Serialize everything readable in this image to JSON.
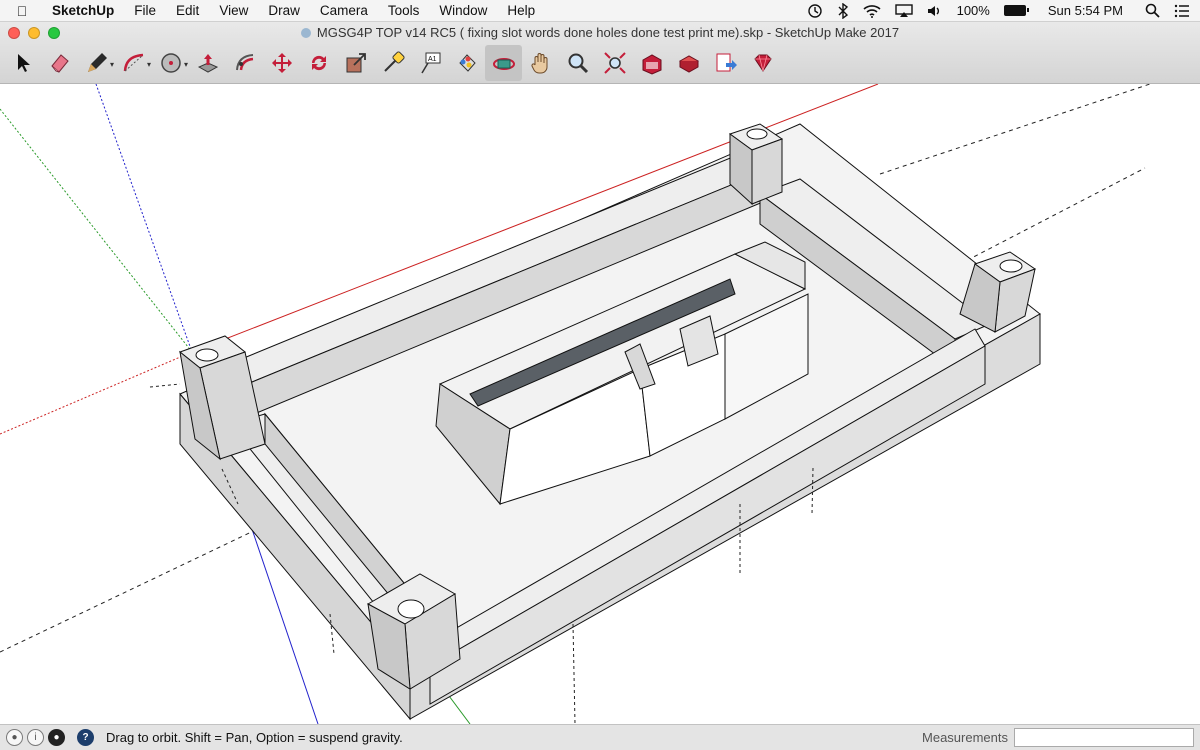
{
  "menubar": {
    "apple_icon": "apple-logo",
    "app_name": "SketchUp",
    "items": [
      "File",
      "Edit",
      "View",
      "Draw",
      "Camera",
      "Tools",
      "Window",
      "Help"
    ],
    "battery": "100%",
    "clock": "Sun 5:54 PM"
  },
  "window": {
    "title": "MGSG4P TOP v14 RC5 ( fixing slot words done holes done test print me).skp - SketchUp Make 2017",
    "traffic_colors": [
      "#ff5f57",
      "#febc2e",
      "#28c840"
    ]
  },
  "toolbar": {
    "tools": [
      {
        "name": "select",
        "icon": "arrow-cursor-icon"
      },
      {
        "name": "eraser",
        "icon": "eraser-icon"
      },
      {
        "name": "line",
        "icon": "pencil-icon",
        "dropdown": true
      },
      {
        "name": "arc",
        "icon": "arc-icon",
        "dropdown": true
      },
      {
        "name": "shapes",
        "icon": "circle-icon",
        "dropdown": true
      },
      {
        "name": "push-pull",
        "icon": "push-pull-icon"
      },
      {
        "name": "offset",
        "icon": "offset-icon"
      },
      {
        "name": "move",
        "icon": "move-icon"
      },
      {
        "name": "rotate",
        "icon": "rotate-icon"
      },
      {
        "name": "scale",
        "icon": "scale-icon"
      },
      {
        "name": "tape-measure",
        "icon": "tape-measure-icon"
      },
      {
        "name": "text",
        "icon": "text-icon",
        "label": "A1"
      },
      {
        "name": "paint-bucket",
        "icon": "paint-bucket-icon"
      },
      {
        "name": "orbit",
        "icon": "orbit-icon",
        "active": true
      },
      {
        "name": "pan",
        "icon": "hand-icon"
      },
      {
        "name": "zoom",
        "icon": "zoom-icon"
      },
      {
        "name": "zoom-extents",
        "icon": "zoom-extents-icon"
      },
      {
        "name": "3d-warehouse",
        "icon": "warehouse-icon"
      },
      {
        "name": "extension-warehouse",
        "icon": "extension-icon"
      },
      {
        "name": "send-to-layout",
        "icon": "layout-icon"
      },
      {
        "name": "extension-manager",
        "icon": "ruby-icon"
      }
    ]
  },
  "statusbar": {
    "hint": "Drag to orbit. Shift = Pan, Option = suspend gravity.",
    "measurements_label": "Measurements",
    "measurements_value": ""
  },
  "colors": {
    "face_top": "#f3f3f3",
    "face_side": "#d6d6d6",
    "face_dark": "#5a6066",
    "red_axis": "#cc2222",
    "green_axis": "#2a9a2a",
    "blue_axis": "#2222cc"
  }
}
